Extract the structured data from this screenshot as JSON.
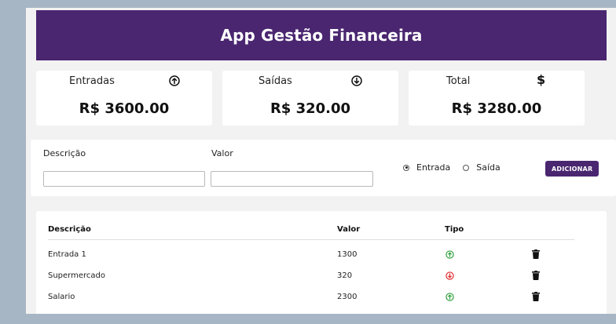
{
  "app": {
    "title": "App Gestão Financeira"
  },
  "summary": {
    "entradas": {
      "label": "Entradas",
      "amount": "R$ 3600.00",
      "icon": "arrow-up-circle-icon"
    },
    "saidas": {
      "label": "Saídas",
      "amount": "R$ 320.00",
      "icon": "arrow-down-circle-icon"
    },
    "total": {
      "label": "Total",
      "amount": "R$ 3280.00",
      "symbol": "$"
    }
  },
  "form": {
    "descricao_label": "Descrição",
    "valor_label": "Valor",
    "descricao_value": "",
    "valor_value": "",
    "option_entrada": "Entrada",
    "option_saida": "Saída",
    "selected": "Entrada",
    "add_button": "ADICIONAR"
  },
  "table": {
    "headers": {
      "descricao": "Descrição",
      "valor": "Valor",
      "tipo": "Tipo"
    },
    "rows": [
      {
        "descricao": "Entrada 1",
        "valor": "1300",
        "tipo": "entrada"
      },
      {
        "descricao": "Supermercado",
        "valor": "320",
        "tipo": "saida"
      },
      {
        "descricao": "Salario",
        "valor": "2300",
        "tipo": "entrada"
      }
    ]
  },
  "colors": {
    "brand": "#4a2670",
    "entrada": "#2e9e3a",
    "saida": "#e0242b",
    "background": "#a7b6c5"
  }
}
